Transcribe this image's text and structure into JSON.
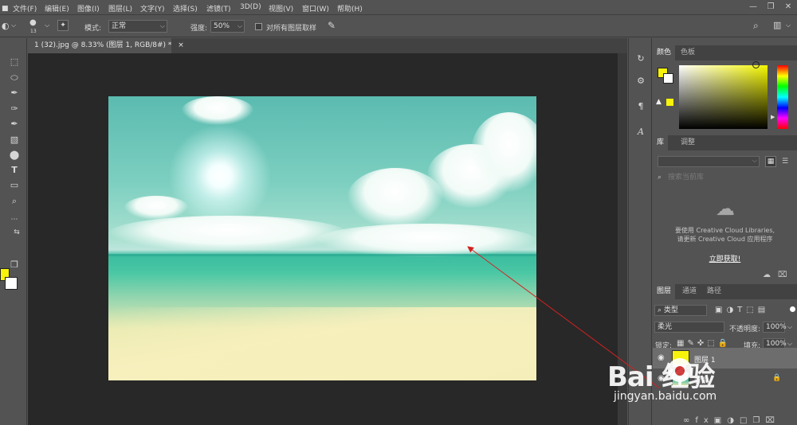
{
  "menu": [
    "文件(F)",
    "编辑(E)",
    "图像(I)",
    "图层(L)",
    "文字(Y)",
    "选择(S)",
    "滤镜(T)",
    "3D(D)",
    "视图(V)",
    "窗口(W)",
    "帮助(H)"
  ],
  "options": {
    "brush_size": "13",
    "mode_label": "模式:",
    "mode_value": "正常",
    "strength_label": "强度:",
    "strength_value": "50%",
    "sample_all_label": "对所有图层取样"
  },
  "document": {
    "tab_title": "1 (32).jpg @ 8.33% (图层 1, RGB/8#) *",
    "close_glyph": "×"
  },
  "color_panel": {
    "tabs": [
      "颜色",
      "色板"
    ],
    "foreground": "#f7f30a",
    "background": "#ffffff"
  },
  "library_panel": {
    "tabs": [
      "库",
      "调整"
    ],
    "search_placeholder": "搜索当前库",
    "message_line1": "要使用 Creative Cloud Libraries,",
    "message_line2": "请更新 Creative Cloud 应用程序",
    "action": "立即获取!"
  },
  "layers_panel": {
    "tabs": [
      "图层",
      "通道",
      "路径"
    ],
    "filter_kind": "类型",
    "blend_mode": "柔光",
    "opacity_label": "不透明度:",
    "opacity_value": "100%",
    "lock_label": "锁定:",
    "fill_label": "填充:",
    "fill_value": "100%",
    "layers": [
      {
        "name": "图层 1",
        "selected": true,
        "thumb_color": "#f7f30a"
      },
      {
        "name": "背景",
        "selected": false,
        "locked": true
      }
    ]
  },
  "watermark": {
    "logo": "Bai  经验",
    "sub": "jingyan.baidu.com"
  },
  "colors": {
    "ui_bg": "#535353",
    "canvas_bg": "#282828",
    "arrow": "#d42020"
  }
}
